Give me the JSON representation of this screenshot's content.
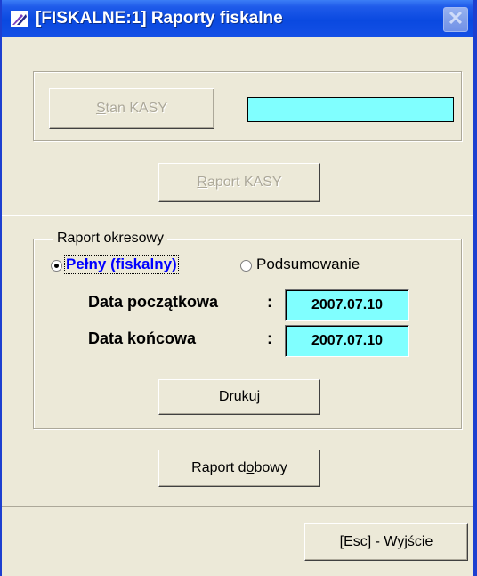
{
  "window": {
    "title": "[FISKALNE:1]  Raporty fiskalne",
    "close_symbol": "✕"
  },
  "stan": {
    "button_pre": "",
    "button_mnemonic": "S",
    "button_post": "tan KASY",
    "display_value": ""
  },
  "raport_kasy": {
    "button_pre": "",
    "button_mnemonic": "R",
    "button_post": "aport KASY"
  },
  "okresowy": {
    "legend": "Raport okresowy",
    "radio_full": "Pełny (fiskalny)",
    "radio_summary": "Podsumowanie",
    "selected": "full",
    "start_label": "Data początkowa",
    "start_colon": ":",
    "start_value": "2007.07.10",
    "end_label": "Data końcowa",
    "end_colon": ":",
    "end_value": "2007.07.10",
    "print_pre": "",
    "print_mnemonic": "D",
    "print_post": "rukuj"
  },
  "dobowy": {
    "button_pre": "Raport d",
    "button_mnemonic": "o",
    "button_post": "bowy"
  },
  "exit": {
    "label": "[Esc] - Wyjście"
  },
  "colors": {
    "title_bar": "#0a49e0",
    "window_bg": "#ece9d8",
    "field_bg": "#80ffff",
    "active_radio_text": "#0000ff"
  }
}
